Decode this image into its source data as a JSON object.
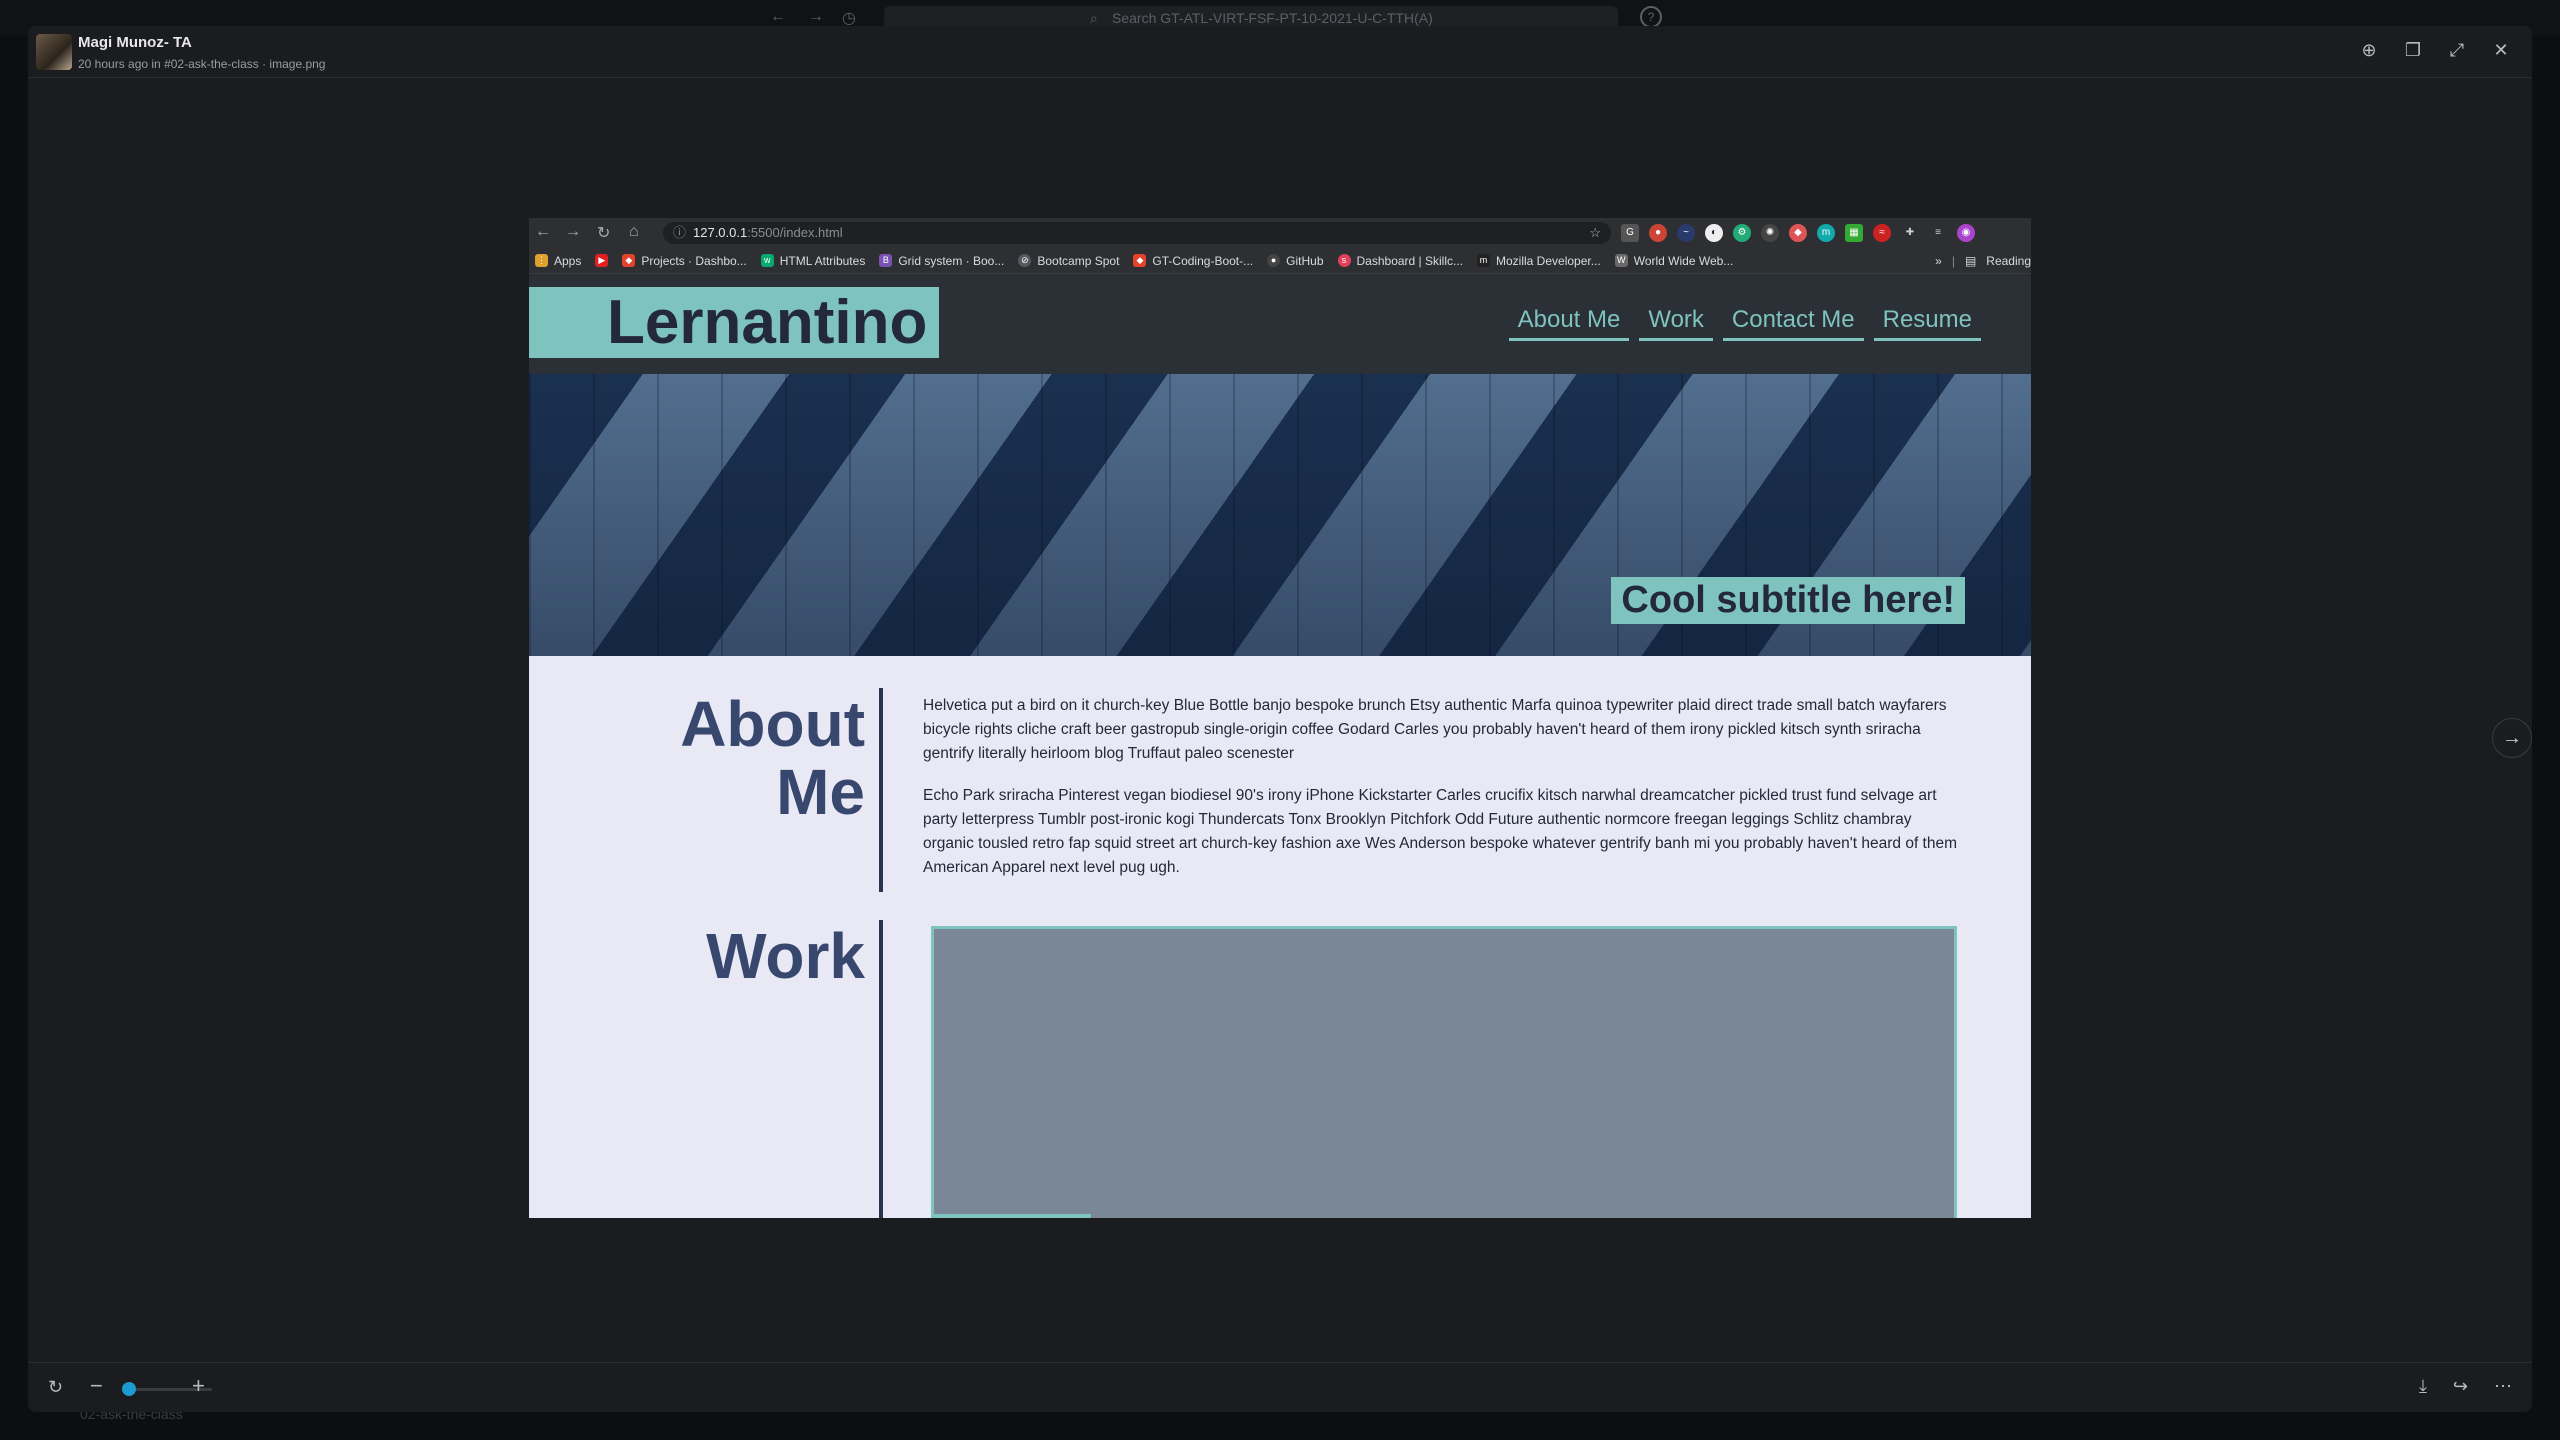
{
  "slack": {
    "search_placeholder": "Search GT-ATL-VIRT-FSF-PT-10-2021-U-C-TTH(A)",
    "bottom_channel": "02-ask-the-class"
  },
  "viewer": {
    "author": "Magi Munoz- TA",
    "meta": "20 hours ago in #02-ask-the-class  ·  image.png",
    "header_icons": [
      "zoom-icon",
      "copy-icon",
      "expand-icon",
      "close-icon"
    ],
    "footer_icons": [
      "download-icon",
      "share-icon",
      "more-icon"
    ]
  },
  "browser": {
    "url_host": "127.0.0.1",
    "url_path": ":5500/index.html",
    "bookmarks": [
      {
        "label": "Apps",
        "icon": "apps-grid-icon",
        "color": "#e0a030"
      },
      {
        "label": "",
        "icon": "youtube-icon",
        "color": "#e02020"
      },
      {
        "label": "Projects · Dashbo...",
        "icon": "gitlab-icon",
        "color": "#e2432a"
      },
      {
        "label": "HTML Attributes",
        "icon": "w3schools-icon",
        "color": "#04aa6d"
      },
      {
        "label": "Grid system · Boo...",
        "icon": "bootstrap-icon",
        "color": "#7952b3"
      },
      {
        "label": "Bootcamp Spot",
        "icon": "bootcampspot-icon",
        "color": "#555a60"
      },
      {
        "label": "GT-Coding-Boot-...",
        "icon": "gitlab-icon",
        "color": "#e2432a"
      },
      {
        "label": "GitHub",
        "icon": "github-icon",
        "color": "#444"
      },
      {
        "label": "Dashboard | Skillc...",
        "icon": "skillcrush-icon",
        "color": "#e0405a"
      },
      {
        "label": "Mozilla Developer...",
        "icon": "mozilla-icon",
        "color": "#222"
      },
      {
        "label": "World Wide Web...",
        "icon": "wikipedia-icon",
        "color": "#6a6a6a"
      }
    ],
    "bookmarks_more": "»",
    "reading_list": "Reading"
  },
  "site": {
    "logo": "Lernantino",
    "nav": [
      "About Me",
      "Work",
      "Contact Me",
      "Resume"
    ],
    "subtitle": "Cool subtitle here!",
    "about_title_line1": "About",
    "about_title_line2": "Me",
    "about_p1": "Helvetica put a bird on it church-key Blue Bottle banjo bespoke brunch Etsy authentic Marfa quinoa typewriter plaid direct trade small batch wayfarers bicycle rights cliche craft beer gastropub single-origin coffee Godard Carles you probably haven't heard of them irony pickled kitsch synth sriracha gentrify literally heirloom blog Truffaut paleo scenester",
    "about_p2": "Echo Park sriracha Pinterest vegan biodiesel 90's irony iPhone Kickstarter Carles crucifix kitsch narwhal dreamcatcher pickled trust fund selvage art party letterpress Tumblr post-ironic kogi Thundercats Tonx Brooklyn Pitchfork Odd Future authentic normcore freegan leggings Schlitz chambray organic tousled retro fap squid street art church-key fashion axe Wes Anderson bespoke whatever gentrify banh mi you probably haven't heard of them American Apparel next level pug ugh.",
    "work_title": "Work"
  },
  "colors": {
    "accent": "#7ec3be",
    "heading": "#38476e",
    "header_bg": "#2b2f36",
    "page_bg": "#e8e9f4"
  }
}
